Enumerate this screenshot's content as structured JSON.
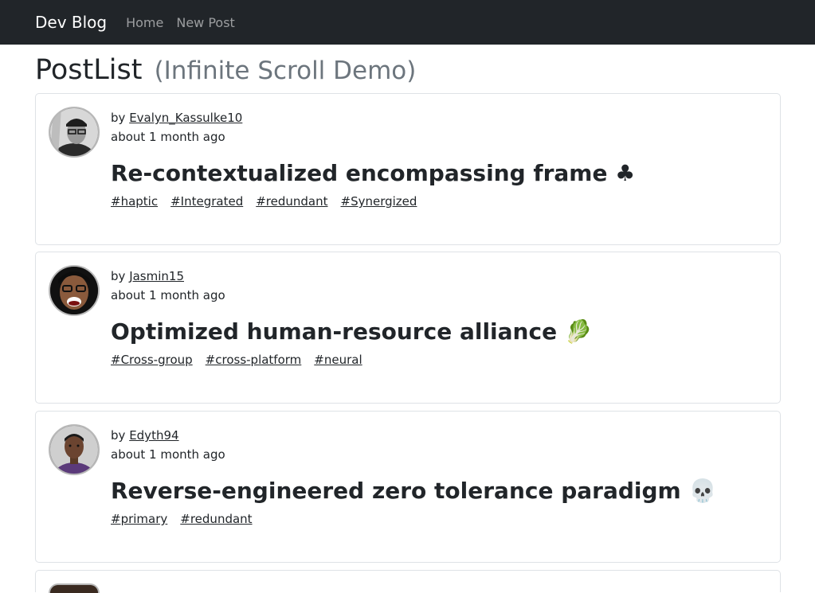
{
  "navbar": {
    "brand": "Dev Blog",
    "links": [
      "Home",
      "New Post"
    ]
  },
  "page": {
    "title": "PostList",
    "subtitle": "(Infinite Scroll Demo)"
  },
  "posts": [
    {
      "by_prefix": "by",
      "author": "Evalyn_Kassulke10",
      "time": "about 1 month ago",
      "title": "Re-contextualized encompassing frame ♣",
      "tags": [
        "#haptic",
        "#Integrated",
        "#redundant",
        "#Synergized"
      ],
      "avatar_icon": "avatar-bw-man-glasses-icon"
    },
    {
      "by_prefix": "by",
      "author": "Jasmin15",
      "time": "about 1 month ago",
      "title": "Optimized human-resource alliance 🥬",
      "tags": [
        "#Cross-group",
        "#cross-platform",
        "#neural"
      ],
      "avatar_icon": "avatar-smiling-glasses-icon"
    },
    {
      "by_prefix": "by",
      "author": "Edyth94",
      "time": "about 1 month ago",
      "title": "Reverse-engineered zero tolerance paradigm 💀",
      "tags": [
        "#primary",
        "#redundant"
      ],
      "avatar_icon": "avatar-man-purple-shirt-icon"
    },
    {
      "by_prefix": "by",
      "author": "",
      "time": "",
      "title": "",
      "tags": [],
      "avatar_icon": "avatar-partial-icon"
    }
  ]
}
